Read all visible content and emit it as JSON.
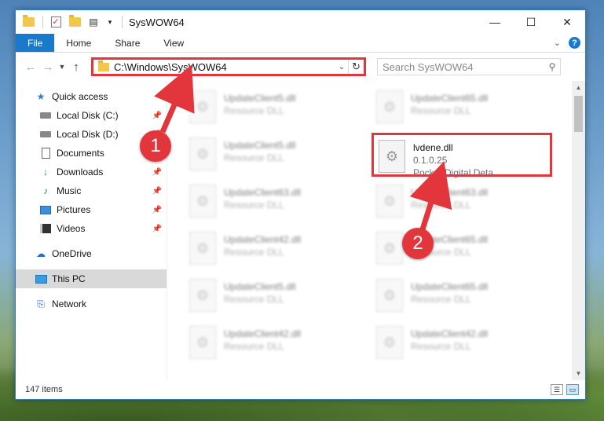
{
  "window": {
    "title": "SysWOW64",
    "minimize": "—",
    "maximize": "☐",
    "close": "✕"
  },
  "ribbon": {
    "tabs": [
      "File",
      "Home",
      "Share",
      "View"
    ],
    "collapse": "⌄",
    "help": "?"
  },
  "address": {
    "path": "C:\\Windows\\SysWOW64",
    "search_placeholder": "Search SysWOW64"
  },
  "sidebar": {
    "items": [
      {
        "label": "Quick access",
        "icon": "star-icon",
        "pinned": false
      },
      {
        "label": "Local Disk (C:)",
        "icon": "disk-icon",
        "pinned": true
      },
      {
        "label": "Local Disk (D:)",
        "icon": "disk-icon",
        "pinned": true
      },
      {
        "label": "Documents",
        "icon": "document-icon",
        "pinned": true
      },
      {
        "label": "Downloads",
        "icon": "download-icon",
        "pinned": true
      },
      {
        "label": "Music",
        "icon": "music-icon",
        "pinned": true
      },
      {
        "label": "Pictures",
        "icon": "pictures-icon",
        "pinned": true
      },
      {
        "label": "Videos",
        "icon": "videos-icon",
        "pinned": true
      },
      {
        "label": "OneDrive",
        "icon": "cloud-icon",
        "pinned": false
      },
      {
        "label": "This PC",
        "icon": "computer-icon",
        "pinned": false,
        "selected": true
      },
      {
        "label": "Network",
        "icon": "network-icon",
        "pinned": false
      }
    ]
  },
  "files": [
    {
      "name": "UpdateClient5.dll",
      "sub": "Resource DLL"
    },
    {
      "name": "UpdateClient65.dll",
      "sub": "Resource DLL"
    },
    {
      "name": "UpdateClient5.dll",
      "sub": "Resource DLL"
    },
    {
      "name": "lvdene.dll",
      "sub": "0.1.0.25",
      "sub2": "Pocket Digital Deta...",
      "highlighted": true
    },
    {
      "name": "UpdateClient63.dll",
      "sub": "Resource DLL"
    },
    {
      "name": "UpdateClient63.dll",
      "sub": "Resource DLL"
    },
    {
      "name": "UpdateClient42.dll",
      "sub": "Resource DLL"
    },
    {
      "name": "UpdateClient65.dll",
      "sub": "Resource DLL"
    },
    {
      "name": "UpdateClient5.dll",
      "sub": "Resource DLL"
    },
    {
      "name": "UpdateClient65.dll",
      "sub": "Resource DLL"
    },
    {
      "name": "UpdateClient42.dll",
      "sub": "Resource DLL"
    },
    {
      "name": "UpdateClient42.dll",
      "sub": "Resource DLL"
    }
  ],
  "status": {
    "item_count": "147 items"
  },
  "annotations": {
    "step1": "1",
    "step2": "2",
    "color": "#e2363c"
  }
}
